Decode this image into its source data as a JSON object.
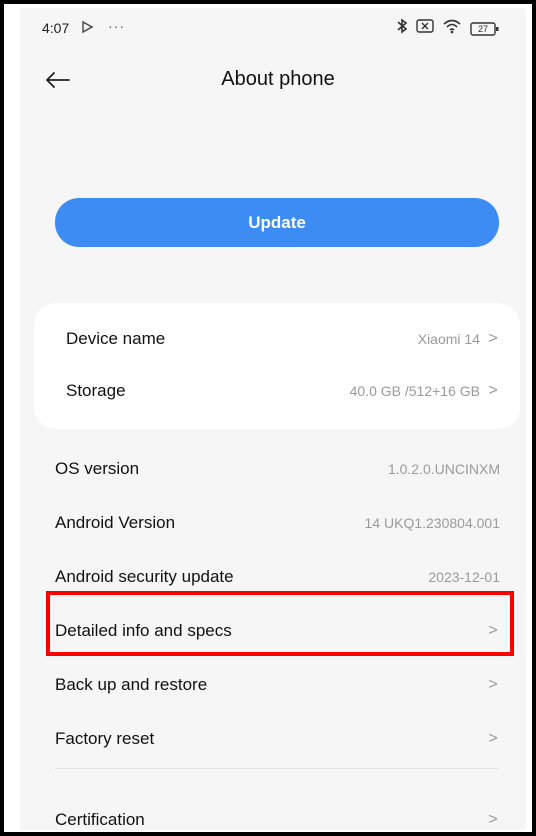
{
  "status_bar": {
    "time": "4:07",
    "more": "···",
    "battery_level": "27",
    "icons": [
      "play-icon",
      "bluetooth-icon",
      "sim-off-icon",
      "wifi-icon",
      "battery-icon"
    ]
  },
  "header": {
    "title": "About phone",
    "back_icon": "arrow-left-icon"
  },
  "update_button": {
    "label": "Update",
    "color": "#3c8cf4"
  },
  "card": {
    "items": [
      {
        "label": "Device name",
        "value": "Xiaomi 14",
        "chevron": ">"
      },
      {
        "label": "Storage",
        "value": "40.0 GB /512+16 GB",
        "chevron": ">"
      }
    ]
  },
  "info": [
    {
      "label": "OS version",
      "value": "1.0.2.0.UNCINXM"
    },
    {
      "label": "Android Version",
      "value": "14 UKQ1.230804.001"
    },
    {
      "label": "Android security update",
      "value": "2023-12-01"
    }
  ],
  "nav_items": [
    {
      "label": "Detailed info and specs",
      "chevron": ">"
    },
    {
      "label": "Back up and restore",
      "chevron": ">"
    },
    {
      "label": "Factory reset",
      "chevron": ">"
    },
    {
      "label": "Certification",
      "chevron": ">"
    }
  ],
  "highlight_color": "#ff0000"
}
